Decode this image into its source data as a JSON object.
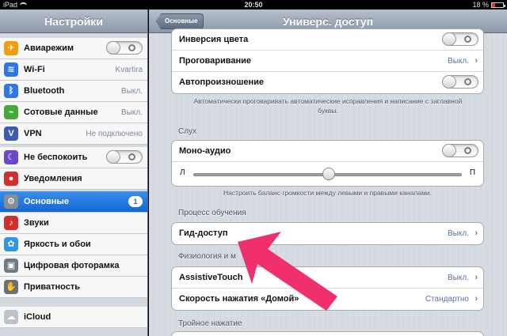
{
  "status_bar": {
    "device": "iPad",
    "time": "20:50",
    "battery_percent": "18 %"
  },
  "sidebar": {
    "title": "Настройки",
    "items": [
      {
        "label": "Авиарежим",
        "icon": "airplane-icon",
        "color": "#f29d0b",
        "type": "toggle",
        "value": ""
      },
      {
        "label": "Wi-Fi",
        "icon": "wifi-icon",
        "color": "#2f76e8",
        "type": "value",
        "value": "Kvartira"
      },
      {
        "label": "Bluetooth",
        "icon": "bluetooth-icon",
        "color": "#2f76e8",
        "type": "value",
        "value": "Выкл."
      },
      {
        "label": "Сотовые данные",
        "icon": "antenna-icon",
        "color": "#45a83a",
        "type": "value",
        "value": "Выкл."
      },
      {
        "label": "VPN",
        "icon": "vpn-icon",
        "color": "#3d5bb2",
        "type": "value",
        "value": "Не подключено"
      },
      {
        "label": "Не беспокоить",
        "icon": "moon-icon",
        "color": "#6949c9",
        "type": "toggle",
        "value": ""
      },
      {
        "label": "Уведомления",
        "icon": "notifications-icon",
        "color": "#d42d2d",
        "type": "none",
        "value": ""
      },
      {
        "label": "Основные",
        "icon": "gear-icon",
        "color": "#888e96",
        "type": "badge",
        "value": "1"
      },
      {
        "label": "Звуки",
        "icon": "speaker-icon",
        "color": "#d42d2d",
        "type": "none",
        "value": ""
      },
      {
        "label": "Яркость и обои",
        "icon": "flower-icon",
        "color": "#3196e6",
        "type": "none",
        "value": ""
      },
      {
        "label": "Цифровая фоторамка",
        "icon": "photo-frame-icon",
        "color": "#6f7985",
        "type": "none",
        "value": ""
      },
      {
        "label": "Приватность",
        "icon": "hand-icon",
        "color": "#6b6f77",
        "type": "none",
        "value": ""
      },
      {
        "label": "iCloud",
        "icon": "cloud-icon",
        "color": "#bcc2cc",
        "type": "none",
        "value": ""
      }
    ]
  },
  "nav": {
    "back_label": "Основные",
    "title": "Универс. доступ"
  },
  "vision_group": {
    "rows": [
      {
        "label": "Инверсия цвета",
        "type": "toggle",
        "value": ""
      },
      {
        "label": "Проговаривание",
        "type": "value",
        "value": "Выкл."
      },
      {
        "label": "Автопроизношение",
        "type": "toggle",
        "value": ""
      }
    ],
    "footnote": "Автоматически проговаривать автоматические исправления и написание с заглавной буквы."
  },
  "hearing": {
    "header": "Слух",
    "mono_audio_label": "Моно-аудио",
    "left_label": "Л",
    "right_label": "П",
    "balance_fraction": 0.5,
    "footnote": "Настроить баланс громкости между левыми и правыми каналами."
  },
  "learning": {
    "header": "Процесс обучения",
    "guided_access_label": "Гид-доступ",
    "guided_access_value": "Выкл."
  },
  "physiology": {
    "header": "Физиология и м",
    "assistive_touch_label": "AssistiveTouch",
    "assistive_touch_value": "Выкл.",
    "home_speed_label": "Скорость нажатия «Домой»",
    "home_speed_value": "Стандартно"
  },
  "triple_click": {
    "header": "Тройное нажатие"
  },
  "annotation": {
    "arrow_color": "#f0306d"
  }
}
